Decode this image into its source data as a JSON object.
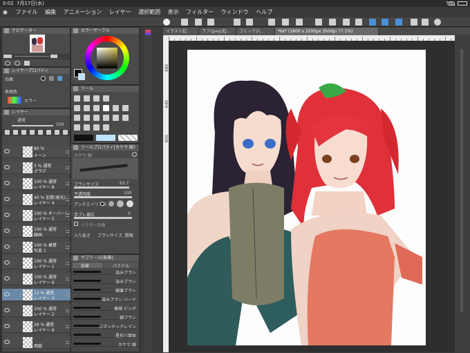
{
  "status": {
    "time": "0:02",
    "date": "7月17日(水)",
    "battery": "7%"
  },
  "menu": [
    "ファイル",
    "編集",
    "アニメーション",
    "レイヤー",
    "選択範囲",
    "表示",
    "フィルター",
    "ウィンドウ",
    "ヘルプ"
  ],
  "panels": {
    "navigator": "ナビゲーター",
    "color_circle": "カラーサークル",
    "layer_property": "レイヤープロパティ",
    "effect_label": "効果",
    "display_color_label": "表現色",
    "display_color_value": "カラー",
    "layer": "レイヤー",
    "tool": "ツール",
    "tool_property": "ツールプロパティ[カケウ 線]",
    "sub_tool": "サブツール[鉛筆]"
  },
  "layer_blend": {
    "mode": "通常",
    "opacity": "100"
  },
  "layers": [
    {
      "mode": "80 %",
      "name": "トーン"
    },
    {
      "mode": "5 % 通常",
      "name": "グラデ"
    },
    {
      "mode": "100 % 通常",
      "name": "レイヤー 8"
    },
    {
      "mode": "40 % 加算(発光)",
      "name": "レイヤー 4"
    },
    {
      "mode": "100 % オーバーレイ",
      "name": "レイヤー 5"
    },
    {
      "mode": "100 % 通常",
      "name": "線画"
    },
    {
      "mode": "100 % 乗算",
      "name": "写真 1"
    },
    {
      "mode": "100 % 通常",
      "name": "レイヤー 1"
    },
    {
      "mode": "100 % 通常",
      "name": "レイヤー 6"
    },
    {
      "mode": "12 % 通常",
      "name": "レイヤー 3",
      "selected": true
    },
    {
      "mode": "100 % 通常",
      "name": "レイヤー 2"
    },
    {
      "mode": "26 % 通常",
      "name": "レイヤー 9"
    },
    {
      "mode": "",
      "name": "用紙"
    }
  ],
  "tool_property": {
    "tool_name": "カケウ 線",
    "brush_size_label": "ブラシサイズ",
    "brush_size_value": "93.7",
    "opacity_label": "不透明度",
    "opacity_value": "100",
    "antialias_label": "アンチエイリアス",
    "stabilizer_label": "手ブレ補正",
    "stabilizer_value": "0",
    "vector_label": "ベクター吸着",
    "start_end_label": "入り抜き",
    "start_end_value": "ブラシサイズ, 間隔"
  },
  "sub_tool_tabs": [
    "鉛筆",
    "パステル"
  ],
  "brushes": [
    "染みブラシ",
    "染みブラシ",
    "鋼筆ブラシ",
    "染みブラシ ハード",
    "模様 ピング",
    "鋼ブラシ",
    "ロマンチックレイン",
    "星形八面体",
    "カケウ 線"
  ],
  "document_tabs": [
    "イラスト起..",
    "ラフ(jpeg)起..",
    "コミック2(..",
    "*kk* (1800 x 2200px 350dpi 77.1%)"
  ],
  "ruler": {
    "left_labels": [
      "480",
      "640",
      "800"
    ]
  },
  "colors": {
    "accent_selected": "#6b8aa8",
    "panel_bg": "#4a4a4a",
    "canvas_bg": "#2e2e2e"
  }
}
